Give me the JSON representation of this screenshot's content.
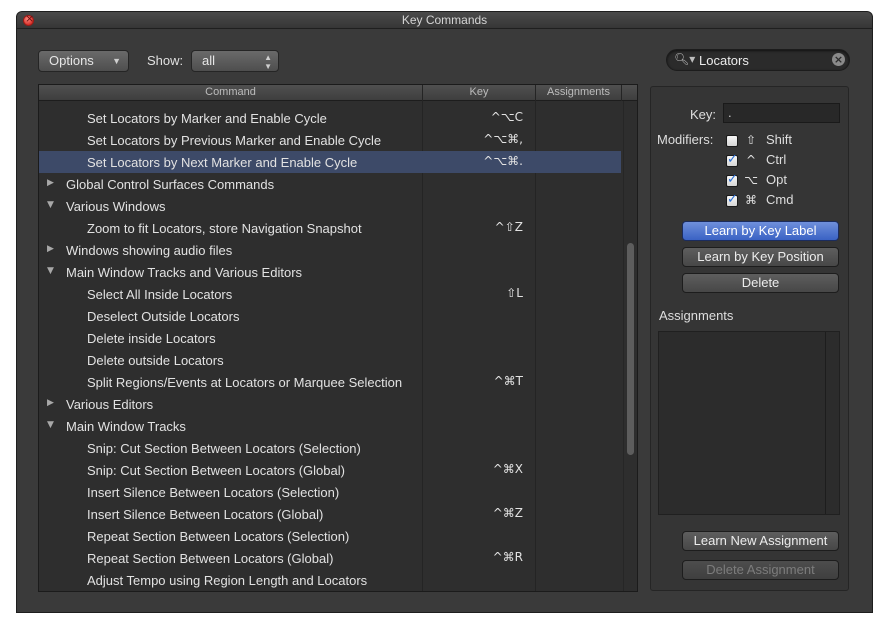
{
  "window": {
    "title": "Key Commands"
  },
  "toolbar": {
    "options_label": "Options",
    "show_label": "Show:",
    "show_value": "all",
    "search_value": "Locators"
  },
  "table": {
    "headers": {
      "command": "Command",
      "key": "Key",
      "assignments": "Assignments"
    },
    "rows": [
      {
        "label": "Set Locators by Marker and Enable Cycle",
        "key": "^⌥C",
        "level": 1,
        "group": "",
        "selected": false
      },
      {
        "label": "Set Locators by Previous Marker and Enable Cycle",
        "key": "^⌥⌘,",
        "level": 1,
        "group": "",
        "selected": false
      },
      {
        "label": "Set Locators by Next Marker and Enable Cycle",
        "key": "^⌥⌘.",
        "level": 1,
        "group": "",
        "selected": true
      },
      {
        "label": "Global Control Surfaces Commands",
        "key": "",
        "level": 0,
        "group": "closed",
        "selected": false
      },
      {
        "label": "Various Windows",
        "key": "",
        "level": 0,
        "group": "open",
        "selected": false
      },
      {
        "label": "Zoom to fit Locators, store Navigation Snapshot",
        "key": "^⇧Z",
        "level": 1,
        "group": "",
        "selected": false
      },
      {
        "label": "Windows showing audio files",
        "key": "",
        "level": 0,
        "group": "closed",
        "selected": false
      },
      {
        "label": "Main Window Tracks and Various Editors",
        "key": "",
        "level": 0,
        "group": "open",
        "selected": false
      },
      {
        "label": "Select All Inside Locators",
        "key": "⇧L",
        "level": 1,
        "group": "",
        "selected": false
      },
      {
        "label": "Deselect Outside Locators",
        "key": "",
        "level": 1,
        "group": "",
        "selected": false
      },
      {
        "label": "Delete inside Locators",
        "key": "",
        "level": 1,
        "group": "",
        "selected": false
      },
      {
        "label": "Delete outside Locators",
        "key": "",
        "level": 1,
        "group": "",
        "selected": false
      },
      {
        "label": "Split Regions/Events at Locators or Marquee Selection",
        "key": "^⌘T",
        "level": 1,
        "group": "",
        "selected": false
      },
      {
        "label": "Various Editors",
        "key": "",
        "level": 0,
        "group": "closed",
        "selected": false
      },
      {
        "label": "Main Window Tracks",
        "key": "",
        "level": 0,
        "group": "open",
        "selected": false
      },
      {
        "label": "Snip: Cut Section Between Locators (Selection)",
        "key": "",
        "level": 1,
        "group": "",
        "selected": false
      },
      {
        "label": "Snip: Cut Section Between Locators (Global)",
        "key": "^⌘X",
        "level": 1,
        "group": "",
        "selected": false
      },
      {
        "label": "Insert Silence Between Locators (Selection)",
        "key": "",
        "level": 1,
        "group": "",
        "selected": false
      },
      {
        "label": "Insert Silence Between Locators (Global)",
        "key": "^⌘Z",
        "level": 1,
        "group": "",
        "selected": false
      },
      {
        "label": "Repeat Section Between Locators (Selection)",
        "key": "",
        "level": 1,
        "group": "",
        "selected": false
      },
      {
        "label": "Repeat Section Between Locators (Global)",
        "key": "^⌘R",
        "level": 1,
        "group": "",
        "selected": false
      },
      {
        "label": "Adjust Tempo using Region Length and Locators",
        "key": "",
        "level": 1,
        "group": "",
        "selected": false
      }
    ]
  },
  "panel": {
    "key_label": "Key:",
    "key_value": ".",
    "modifiers_label": "Modifiers:",
    "modifiers": [
      {
        "symbol": "⇧",
        "label": "Shift",
        "checked": false
      },
      {
        "symbol": "^",
        "label": "Ctrl",
        "checked": true
      },
      {
        "symbol": "⌥",
        "label": "Opt",
        "checked": true
      },
      {
        "symbol": "⌘",
        "label": "Cmd",
        "checked": true
      }
    ],
    "learn_by_label": "Learn by Key Label",
    "learn_by_position": "Learn by Key Position",
    "delete_label": "Delete",
    "assignments_label": "Assignments",
    "learn_new": "Learn New Assignment",
    "delete_assignment": "Delete Assignment"
  },
  "colors": {
    "selection": "#3d4a68",
    "primary_button": "#4a72d0",
    "checkbox_check": "#2a6fd6"
  }
}
